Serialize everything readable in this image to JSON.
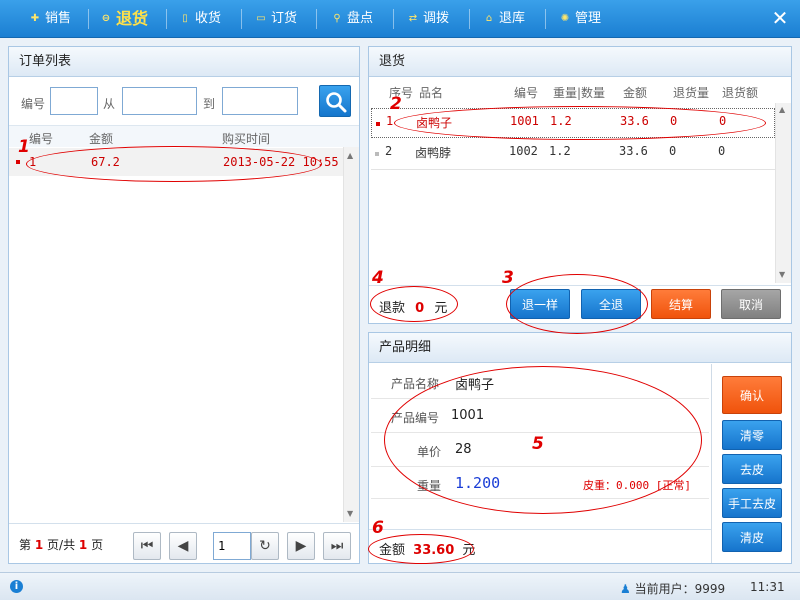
{
  "nav": {
    "items": [
      {
        "label": "销售",
        "icon": "plus-icon"
      },
      {
        "label": "退货",
        "icon": "minus-icon",
        "active": true
      },
      {
        "label": "收货",
        "icon": "document-icon"
      },
      {
        "label": "订货",
        "icon": "chat-icon"
      },
      {
        "label": "盘点",
        "icon": "search-icon"
      },
      {
        "label": "调拨",
        "icon": "transfer-icon"
      },
      {
        "label": "退库",
        "icon": "home-icon"
      },
      {
        "label": "管理",
        "icon": "gear-icon"
      }
    ],
    "close": "✕"
  },
  "order_list": {
    "title": "订单列表",
    "search": {
      "no_label": "编号",
      "from_label": "从",
      "to_label": "到",
      "no_value": "",
      "from_value": "",
      "to_value": ""
    },
    "columns": [
      "编号",
      "金额",
      "购买时间"
    ],
    "rows": [
      {
        "no": "1",
        "amount": "67.2",
        "time": "2013-05-22 10:55"
      }
    ],
    "pager": {
      "prefix": "第",
      "page": "1",
      "mid": "页/共",
      "total": "1",
      "suffix": "页",
      "input": "1"
    }
  },
  "returns": {
    "title": "退货",
    "columns": [
      "序号",
      "品名",
      "编号",
      "重量|数量",
      "金额",
      "退货量",
      "退货额"
    ],
    "rows": [
      {
        "seq": "1",
        "name": "卤鸭子",
        "code": "1001",
        "weight": "1.2",
        "amount": "33.6",
        "ret_qty": "0",
        "ret_amt": "0"
      },
      {
        "seq": "2",
        "name": "卤鸭脖",
        "code": "1002",
        "weight": "1.2",
        "amount": "33.6",
        "ret_qty": "0",
        "ret_amt": "0"
      }
    ],
    "refund_label": "退款",
    "refund_value": "0",
    "refund_unit": "元",
    "buttons": {
      "return_one": "退一样",
      "return_all": "全退",
      "checkout": "结算",
      "cancel": "取消"
    }
  },
  "detail": {
    "title": "产品明细",
    "fields": [
      {
        "label": "产品名称",
        "value": "卤鸭子"
      },
      {
        "label": "产品编号",
        "value": "1001"
      },
      {
        "label": "单价",
        "value": "28"
      },
      {
        "label": "重量",
        "value": "1.200"
      }
    ],
    "tare": "皮重：0.000 [正常]",
    "amount_label": "金额",
    "amount_value": "33.60",
    "amount_unit": "元",
    "side_buttons": {
      "confirm": "确认",
      "zero": "清零",
      "tare": "去皮",
      "manual_tare": "手工去皮",
      "clear_tare": "清皮"
    }
  },
  "status": {
    "user_label": "当前用户：",
    "user": "9999",
    "time": "11:31"
  },
  "annotations": [
    "1",
    "2",
    "3",
    "4",
    "5",
    "6"
  ],
  "colors": {
    "accent": "#1b7fd2",
    "highlight": "#e00000",
    "orange": "#f0530c",
    "gray": "#808080"
  }
}
